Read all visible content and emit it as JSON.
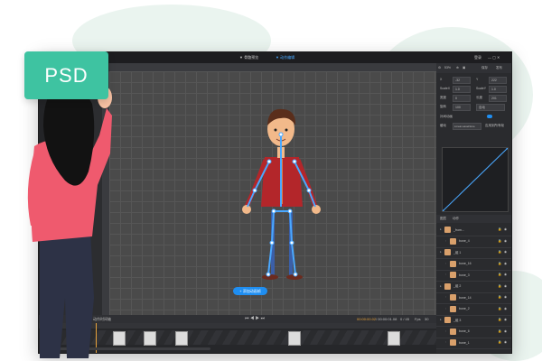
{
  "badge": {
    "label": "PSD"
  },
  "titlebar": {
    "menu_center_1": "▼ 骨骼预览",
    "menu_center_2": "▼ 动作编辑",
    "right_label": "登录"
  },
  "toolbar_right": {
    "zoom": "53%",
    "btn_save": "保存",
    "btn_publish": "发布"
  },
  "properties": {
    "x_label": "X",
    "x_value": "-32",
    "y_label": "Y",
    "y_value": "222",
    "scalex_label": "ScaleX",
    "scalex_value": "1.0",
    "scaley_label": "ScaleY",
    "scaley_value": "1.0",
    "width_label": "宽度",
    "width_value": "0",
    "height_label": "长度",
    "height_value": "201",
    "rotation_label": "旋转",
    "rotation_value": "100",
    "anchor_label": "自动",
    "interp_label": "补间动画",
    "easing_label": "缓动",
    "easing_value": "Linear.easeNone",
    "easing_btn": "应用到所有帧"
  },
  "layers": {
    "tab1": "图层",
    "tab2": "动作",
    "items": [
      {
        "name": "_from..."
      },
      {
        "name": "bone_4"
      },
      {
        "name": "_组 1"
      },
      {
        "name": "bone_16"
      },
      {
        "name": "bone_3"
      },
      {
        "name": "_组 2"
      },
      {
        "name": "bone_14"
      },
      {
        "name": "bone_2"
      },
      {
        "name": "_组 3"
      },
      {
        "name": "bone_6"
      },
      {
        "name": "bone_1"
      }
    ]
  },
  "canvas": {
    "add_button": "+ 添加动画帧"
  },
  "timeline": {
    "label": "动作时间轴",
    "time_current": "00:00:00.02",
    "time_total": "/ 00:00:01.08",
    "frame": "0 / 45",
    "fps": "Fps",
    "fps_value": "30"
  },
  "colors": {
    "accent": "#1f8ef1",
    "badge": "#3ec3a1",
    "panel": "#2a2b2e",
    "canvas": "#4a4a4a"
  }
}
